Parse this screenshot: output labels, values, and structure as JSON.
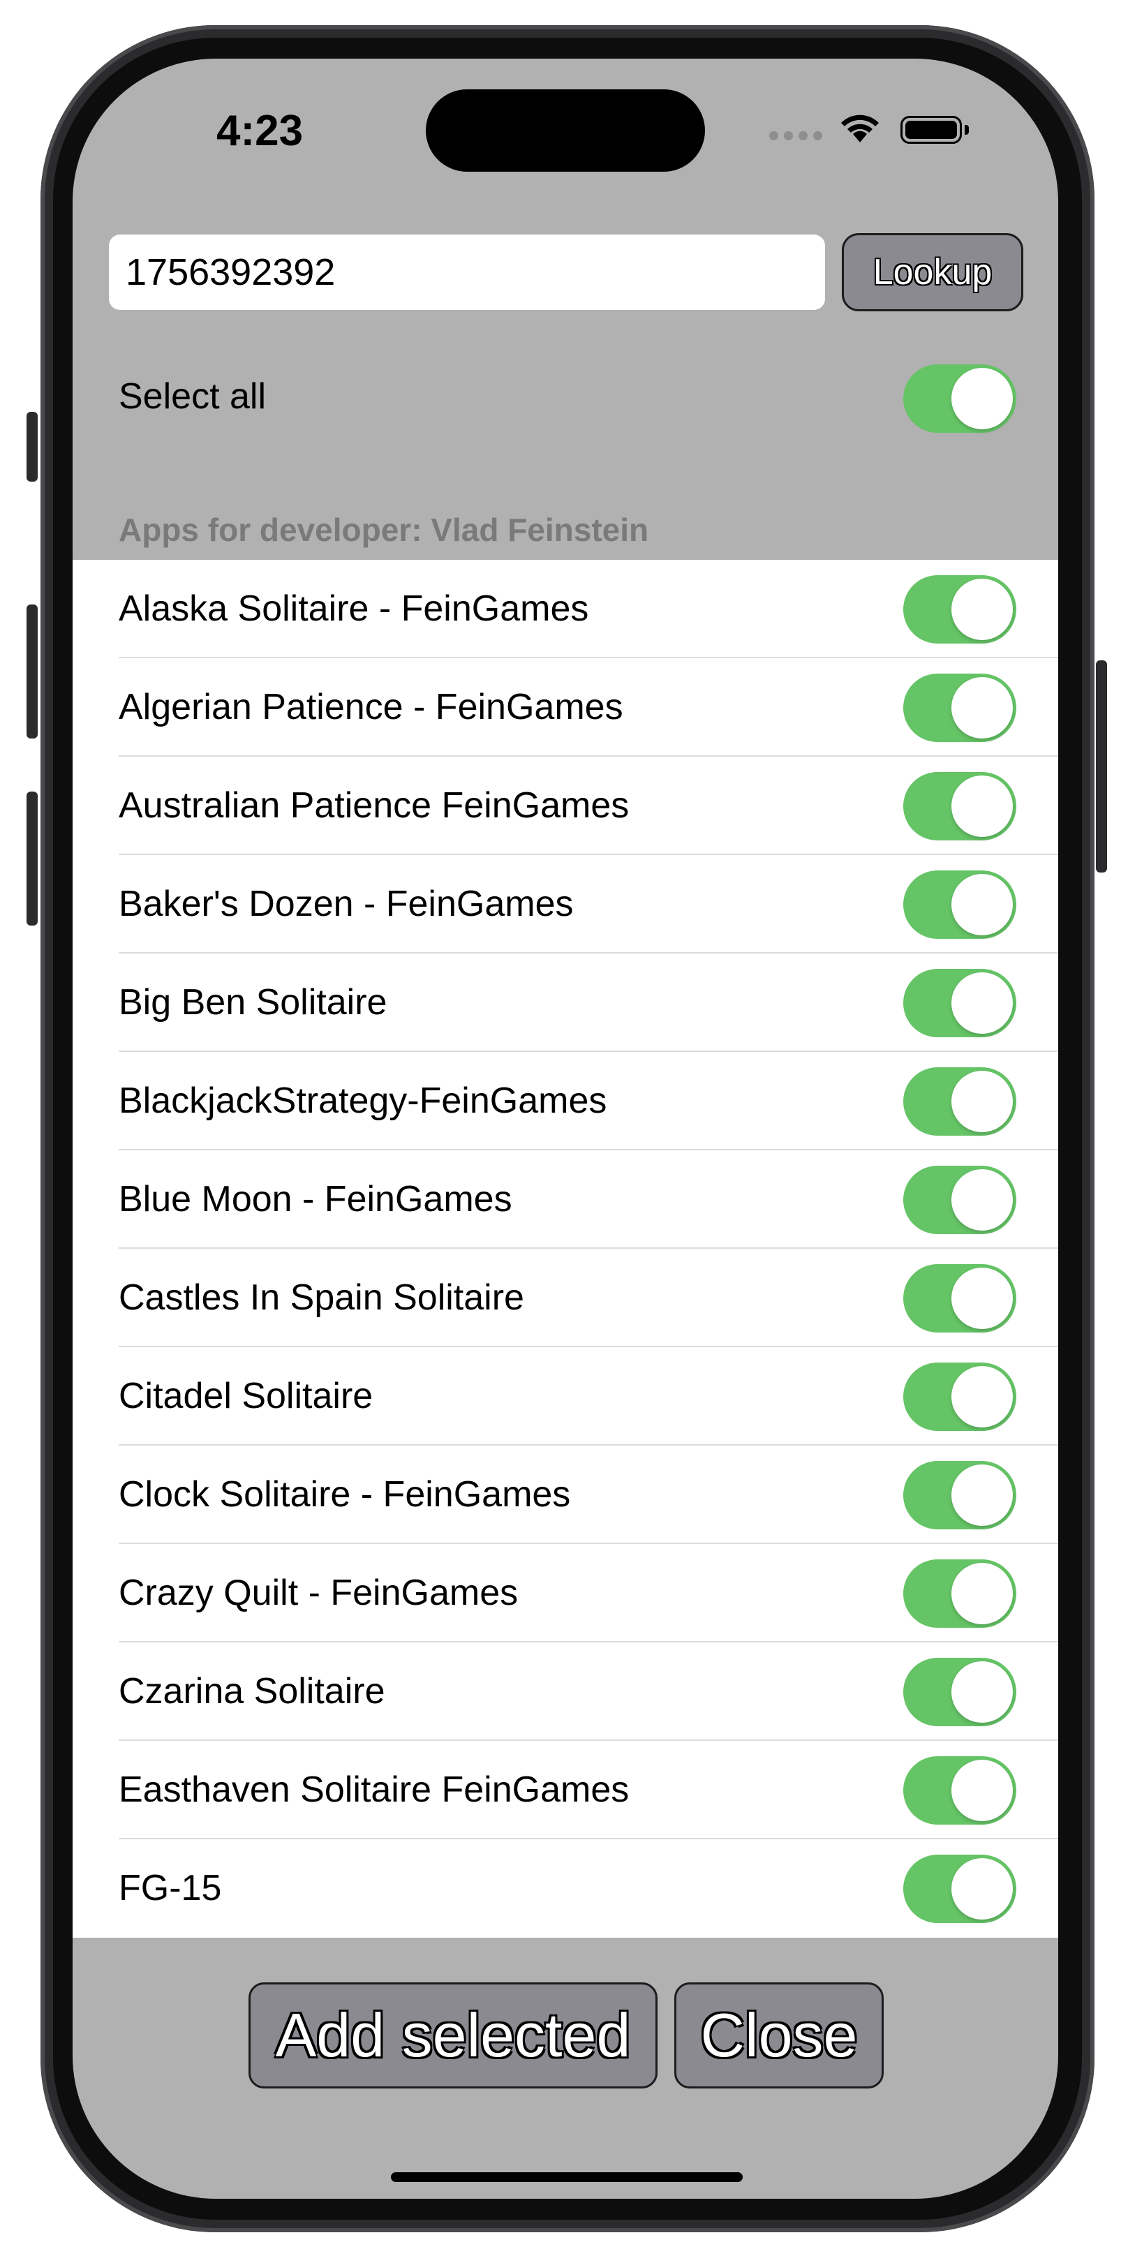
{
  "status_bar": {
    "time": "4:23"
  },
  "lookup": {
    "input_value": "1756392392",
    "button_label": "Lookup"
  },
  "select_all": {
    "label": "Select all",
    "on": true
  },
  "section_header": "Apps for developer: Vlad Feinstein",
  "apps": [
    {
      "name": "Alaska Solitaire - FeinGames",
      "on": true
    },
    {
      "name": "Algerian Patience - FeinGames",
      "on": true
    },
    {
      "name": "Australian Patience FeinGames",
      "on": true
    },
    {
      "name": "Baker's Dozen - FeinGames",
      "on": true
    },
    {
      "name": "Big Ben Solitaire",
      "on": true
    },
    {
      "name": "BlackjackStrategy-FeinGames",
      "on": true
    },
    {
      "name": "Blue Moon - FeinGames",
      "on": true
    },
    {
      "name": "Castles In Spain Solitaire",
      "on": true
    },
    {
      "name": "Citadel Solitaire",
      "on": true
    },
    {
      "name": "Clock Solitaire - FeinGames",
      "on": true
    },
    {
      "name": "Crazy Quilt - FeinGames",
      "on": true
    },
    {
      "name": "Czarina Solitaire",
      "on": true
    },
    {
      "name": "Easthaven Solitaire FeinGames",
      "on": true
    },
    {
      "name": "FG-15",
      "on": true
    }
  ],
  "actions": {
    "add_label": "Add selected",
    "close_label": "Close"
  },
  "icons": [
    "wifi-icon",
    "battery-icon",
    "signal-dots-icon"
  ],
  "colors": {
    "toggle_on": "#65c466",
    "screen_background": "#b1b1b1",
    "button_fill": "#8b8a91"
  }
}
